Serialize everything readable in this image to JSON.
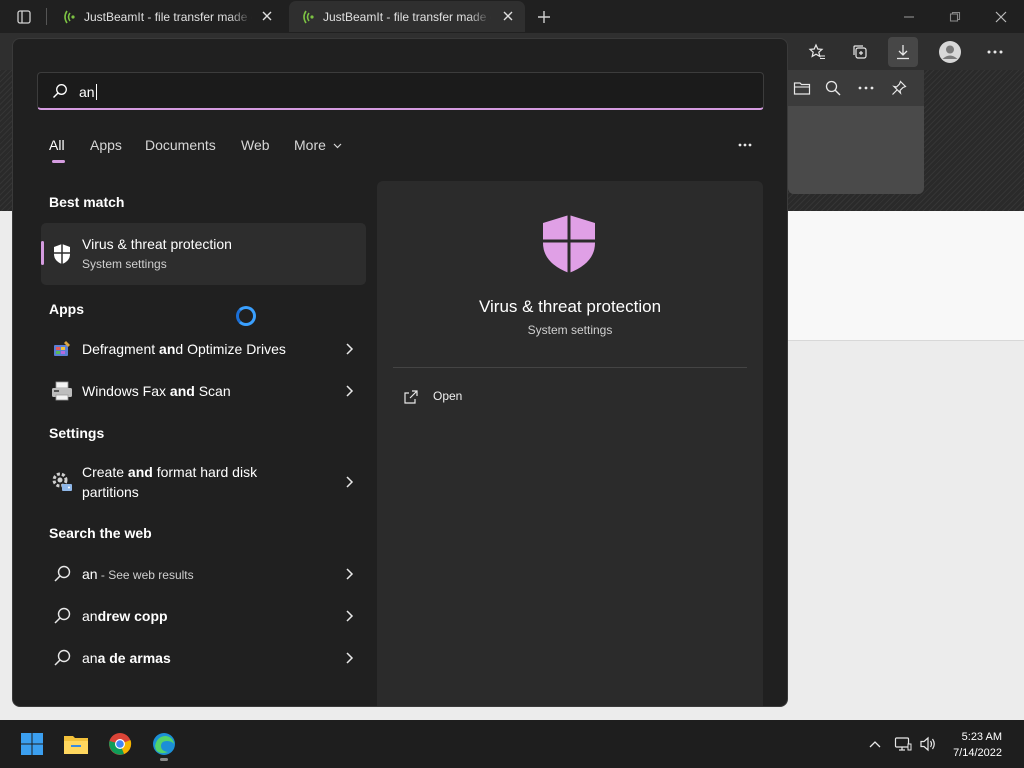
{
  "browser": {
    "tabs": [
      {
        "title": "JustBeamIt - file transfer made easy",
        "active": false
      },
      {
        "title": "JustBeamIt - file transfer made easy",
        "active": true
      }
    ],
    "colors": {
      "titlebar": "#202020",
      "toolbar": "#2f2f2f",
      "tab_favicon": "#7cc243"
    },
    "toolbar_icons": [
      "favorites-icon",
      "collections-icon",
      "downloads-icon",
      "profile-icon",
      "settings-more-icon"
    ],
    "downloads_flyout_icons": [
      "open-folder-icon",
      "search-icon",
      "more-icon",
      "pin-icon"
    ]
  },
  "search": {
    "query": "an",
    "accent": "#d59ce0",
    "filters": [
      {
        "label": "All",
        "active": true
      },
      {
        "label": "Apps",
        "active": false
      },
      {
        "label": "Documents",
        "active": false
      },
      {
        "label": "Web",
        "active": false
      },
      {
        "label": "More",
        "active": false
      }
    ]
  },
  "sections": {
    "best_match": "Best match",
    "apps": "Apps",
    "settings": "Settings",
    "web": "Search the web"
  },
  "best_match": {
    "title": "Virus & threat protection",
    "subtitle": "System settings",
    "icon": "shield-icon"
  },
  "apps": [
    {
      "pre": "Defragment ",
      "bold": "an",
      "post": "d Optimize Drives",
      "icon": "defrag-icon"
    },
    {
      "pre": "Windows Fax ",
      "bold": "and",
      "post": " Scan",
      "icon": "fax-scan-icon"
    }
  ],
  "settings": [
    {
      "line1_pre": "Create ",
      "line1_bold": "and",
      "line1_post": " format hard disk",
      "line2": "partitions",
      "icon": "disk-management-icon"
    }
  ],
  "web": [
    {
      "pre": "an",
      "bold": "",
      "suffix": " - See web results"
    },
    {
      "pre": "an",
      "bold": "drew copp",
      "suffix": ""
    },
    {
      "pre": "an",
      "bold": "a de armas",
      "suffix": ""
    }
  ],
  "detail": {
    "title": "Virus & threat protection",
    "subtitle": "System settings",
    "action_open": "Open",
    "shield_color": "#e0a0e6"
  },
  "taskbar": {
    "apps": [
      "start-icon",
      "file-explorer-icon",
      "chrome-icon",
      "edge-icon"
    ],
    "tray": [
      "chevron-up-icon",
      "network-icon",
      "volume-icon"
    ],
    "time": "5:23 AM",
    "date": "7/14/2022"
  }
}
